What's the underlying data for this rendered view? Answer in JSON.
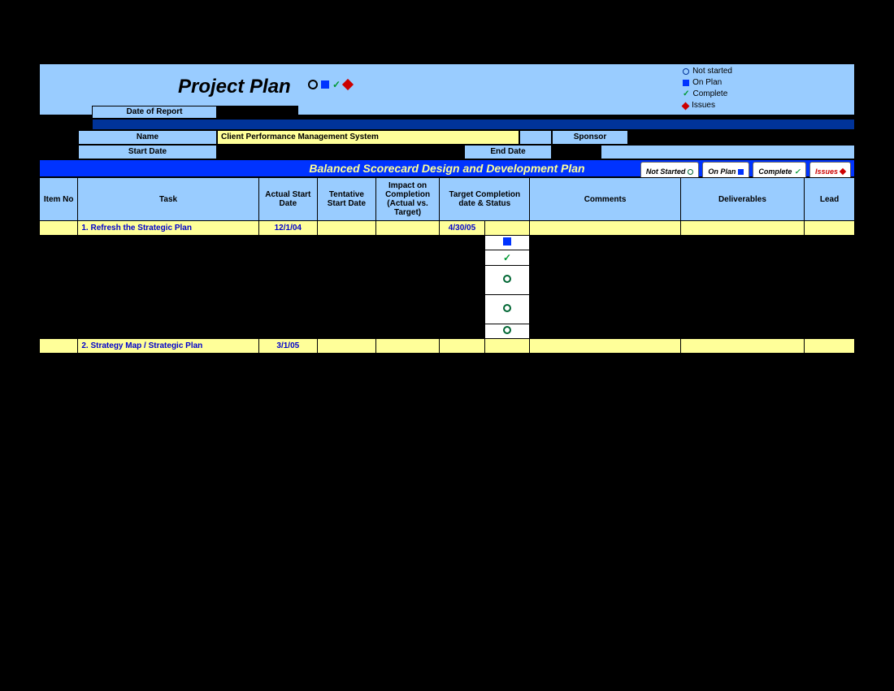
{
  "header": {
    "title": "Project Plan",
    "legend": {
      "not_started": "Not started",
      "on_plan": "On Plan",
      "complete": "Complete",
      "issues": "Issues"
    },
    "date_of_report_label": "Date of Report",
    "name_label": "Name",
    "name_value": "Client Performance Management System",
    "sponsor_label": "Sponsor",
    "start_date_label": "Start Date",
    "end_date_label": "End Date",
    "section_title": "Balanced Scorecard Design and Development Plan",
    "pills": {
      "not_started": "Not Started",
      "on_plan": "On Plan",
      "complete": "Complete",
      "issues": "Issues"
    }
  },
  "columns": {
    "item_no": "Item No",
    "task": "Task",
    "actual_start": "Actual Start Date",
    "tentative_start": "Tentative Start Date",
    "impact": "Impact on Completion (Actual vs. Target)",
    "target": "Target Completion date & Status",
    "comments": "Comments",
    "deliverables": "Deliverables",
    "lead": "Lead"
  },
  "rows": [
    {
      "type": "section",
      "task": "1. Refresh the Strategic Plan",
      "actual_start": "12/1/04",
      "target_date": "4/30/05"
    },
    {
      "type": "detail",
      "status": "square-blue"
    },
    {
      "type": "detail",
      "status": "check-green"
    },
    {
      "type": "detail",
      "status": "circle-open"
    },
    {
      "type": "detail",
      "status": "circle-open"
    },
    {
      "type": "detail",
      "status": "circle-open"
    },
    {
      "type": "section",
      "task": "2. Strategy Map / Strategic Plan",
      "actual_start": "3/1/05",
      "target_date": ""
    }
  ]
}
